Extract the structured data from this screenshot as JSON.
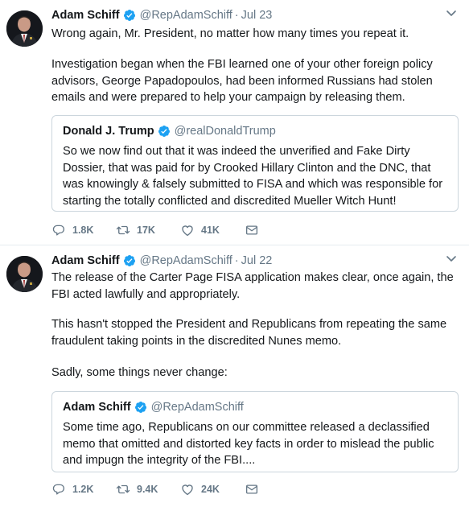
{
  "tweets": [
    {
      "author": {
        "name": "Adam Schiff",
        "handle": "@RepAdamSchiff",
        "date": "Jul 23"
      },
      "separator": "·",
      "paragraphs": [
        "Wrong again, Mr. President, no matter how many times you repeat it.",
        "Investigation began when the FBI learned one of your other foreign policy advisors, George Papadopoulos, had been informed Russians had stolen emails and were prepared to help your campaign by releasing them."
      ],
      "quote": {
        "name": "Donald J. Trump",
        "handle": "@realDonaldTrump",
        "text": "So we now find out that it was indeed the unverified and Fake Dirty Dossier, that was paid for by Crooked Hillary Clinton and the DNC, that was knowingly & falsely submitted to FISA and which was responsible for starting the totally conflicted and discredited Mueller Witch Hunt!"
      },
      "stats": {
        "replies": "1.8K",
        "retweets": "17K",
        "likes": "41K"
      }
    },
    {
      "author": {
        "name": "Adam Schiff",
        "handle": "@RepAdamSchiff",
        "date": "Jul 22"
      },
      "separator": "·",
      "paragraphs": [
        "The release of the Carter Page FISA application makes clear, once again, the FBI acted lawfully and appropriately.",
        "This hasn't stopped the President and Republicans from repeating the same fraudulent taking points in the discredited Nunes memo.",
        "Sadly, some things never change:"
      ],
      "quote": {
        "name": "Adam Schiff",
        "handle": "@RepAdamSchiff",
        "text": "Some time ago, Republicans on our committee released a declassified memo that omitted and distorted key facts in order to mislead the public and impugn the integrity of the FBI...."
      },
      "stats": {
        "replies": "1.2K",
        "retweets": "9.4K",
        "likes": "24K"
      }
    }
  ],
  "colors": {
    "text": "#14171a",
    "secondary": "#657786",
    "verified": "#1da1f2",
    "border": "#e6ecf0",
    "quote_border": "#ccd6dd"
  },
  "icons": [
    "chevron-down-icon",
    "verified-badge-icon",
    "reply-icon",
    "retweet-icon",
    "like-icon",
    "direct-message-icon"
  ]
}
